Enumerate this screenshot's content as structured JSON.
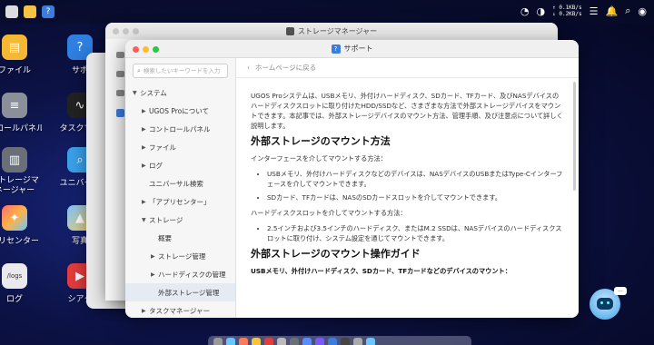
{
  "topbar": {
    "net_up": "↑ 0.1KB/s",
    "net_down": "↓ 0.2KB/s"
  },
  "desktop": {
    "icons": [
      {
        "label": "ファイル"
      },
      {
        "label": "サポ"
      },
      {
        "label": "トロールパネル"
      },
      {
        "label": "タスクマネ"
      },
      {
        "label": "ストレージマネージャー"
      },
      {
        "label": "ユニバーサ"
      },
      {
        "label": "プリセンター"
      },
      {
        "label": "写真"
      },
      {
        "label": "ログ"
      },
      {
        "label": "シアタ"
      }
    ],
    "logs_icon_text": "/logs"
  },
  "storage_window": {
    "title": "ストレージマネージャー"
  },
  "support_window": {
    "title": "サポート",
    "search_placeholder": "検索したいキーワードを入力",
    "back_label": "ホームページに戻る",
    "nav": [
      {
        "label": "システム",
        "expanded": true
      },
      {
        "label": "UGOS Proについて"
      },
      {
        "label": "コントロールパネル"
      },
      {
        "label": "ファイル"
      },
      {
        "label": "ログ"
      },
      {
        "label": "ユニバーサル検索"
      },
      {
        "label": "「アプリセンター」"
      },
      {
        "label": "ストレージ",
        "expanded": true
      },
      {
        "label": "概要"
      },
      {
        "label": "ストレージ管理"
      },
      {
        "label": "ハードディスクの管理"
      },
      {
        "label": "外部ストレージ管理",
        "selected": true
      },
      {
        "label": "タスクマネージャー"
      }
    ],
    "article": {
      "intro": "UGOS Proシステムは、USBメモリ、外付けハードディスク、SDカード、TFカード、及びNASデバイスのハードディスクスロットに取り付けたHDD/SSDなど、さまざまな方法で外部ストレージデバイスをマウントできます。本記事では、外部ストレージデバイスのマウント方法、管理手順、及び注意点について詳しく説明します。",
      "h1": "外部ストレージのマウント方法",
      "interface_lead": "インターフェースを介してマウントする方法：",
      "interface_items": [
        "USBメモリ、外付けハードディスクなどのデバイスは、NASデバイスのUSBまたはType-Cインターフェースを介してマウントできます。",
        "SDカード、TFカードは、NASのSDカードスロットを介してマウントできます。"
      ],
      "slot_lead": "ハードディスクスロットを介してマウントする方法：",
      "slot_items": [
        "2.5インチおよび3.5インチのハードディスク、またはM.2 SSDは、NASデバイスのハードディスクスロットに取り付け、システム設定を通じてマウントできます。"
      ],
      "h2": "外部ストレージのマウント操作ガイド",
      "sub": "USBメモリ、外付けハードディスク、SDカード、TFカードなどのデバイスのマウント："
    }
  },
  "chatbot": {
    "bubble": "..."
  },
  "colors": {
    "accent": "#3b7ddd",
    "close": "#ff5f57",
    "minimize": "#febc2e",
    "maximize": "#28c840"
  }
}
